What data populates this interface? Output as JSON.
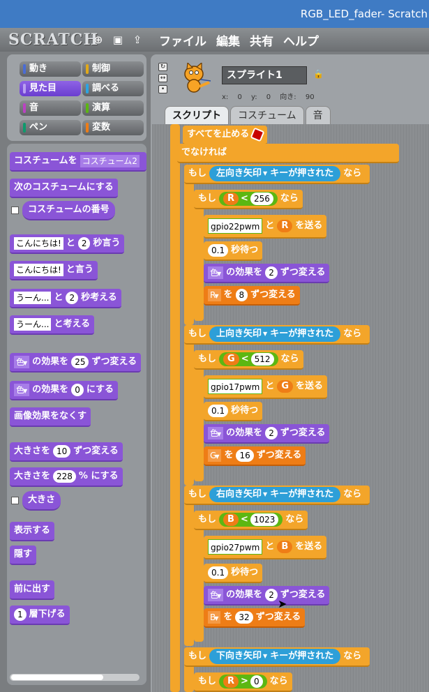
{
  "window": {
    "title": "RGB_LED_fader- Scratch"
  },
  "menubar": {
    "logo": "SCRATCH",
    "items": [
      "ファイル",
      "編集",
      "共有",
      "ヘルプ"
    ]
  },
  "categories": [
    {
      "label": "動き",
      "color": "#4a6cd4"
    },
    {
      "label": "制御",
      "color": "#e1a91a"
    },
    {
      "label": "見た目",
      "color": "#8a55d7"
    },
    {
      "label": "調べる",
      "color": "#2ca5e2"
    },
    {
      "label": "音",
      "color": "#bb42c3"
    },
    {
      "label": "演算",
      "color": "#5cb712"
    },
    {
      "label": "ペン",
      "color": "#0e9a6c"
    },
    {
      "label": "変数",
      "color": "#ee7d16"
    }
  ],
  "palette": {
    "costume_to": "コスチュームを",
    "costume_val": "コスチューム2",
    "next_costume": "次のコスチュームにする",
    "costume_no": "コスチュームの番号",
    "hello": "こんにちは!",
    "to": "と",
    "say_secs_n": "2",
    "say_secs": "秒言う",
    "say": "と言う",
    "hmm": "うーん...",
    "think_secs_n": "2",
    "think_secs": "秒考える",
    "think": "と考える",
    "color": "色",
    "effect_by": "の効果を",
    "effect_by_n": "25",
    "change_by": "ずつ変える",
    "effect_set_n": "0",
    "set_to": "にする",
    "clear_effects": "画像効果をなくす",
    "size_by": "大きさを",
    "size_by_n": "10",
    "size_set_n": "228",
    "size_set_unit": "% にする",
    "size": "大きさ",
    "show": "表示する",
    "hide": "隠す",
    "front": "前に出す",
    "back_n": "1",
    "back": "層下げる"
  },
  "sprite": {
    "name": "スプライト1",
    "coords": "x: 0 y: 0 向き: 90"
  },
  "tabs": [
    "スクリプト",
    "コスチューム",
    "音"
  ],
  "script": {
    "stop_all": "すべてを止める",
    "else": "でなければ",
    "if": "もし",
    "then": "なら",
    "key_pressed": "キーが押された",
    "send": "を送る",
    "wait": "秒待つ",
    "wait_n": "0.1",
    "and": "と",
    "to": "を",
    "keys": [
      "左向き矢印",
      "上向き矢印",
      "右向き矢印",
      "下向き矢印"
    ],
    "vars": [
      "R",
      "G",
      "B"
    ],
    "limits": [
      "256",
      "512",
      "1023",
      "0"
    ],
    "pins": [
      "gpio22pwm",
      "gpio17pwm",
      "gpio27pwm"
    ],
    "color_step": "2",
    "steps": [
      "8",
      "16",
      "32"
    ]
  }
}
